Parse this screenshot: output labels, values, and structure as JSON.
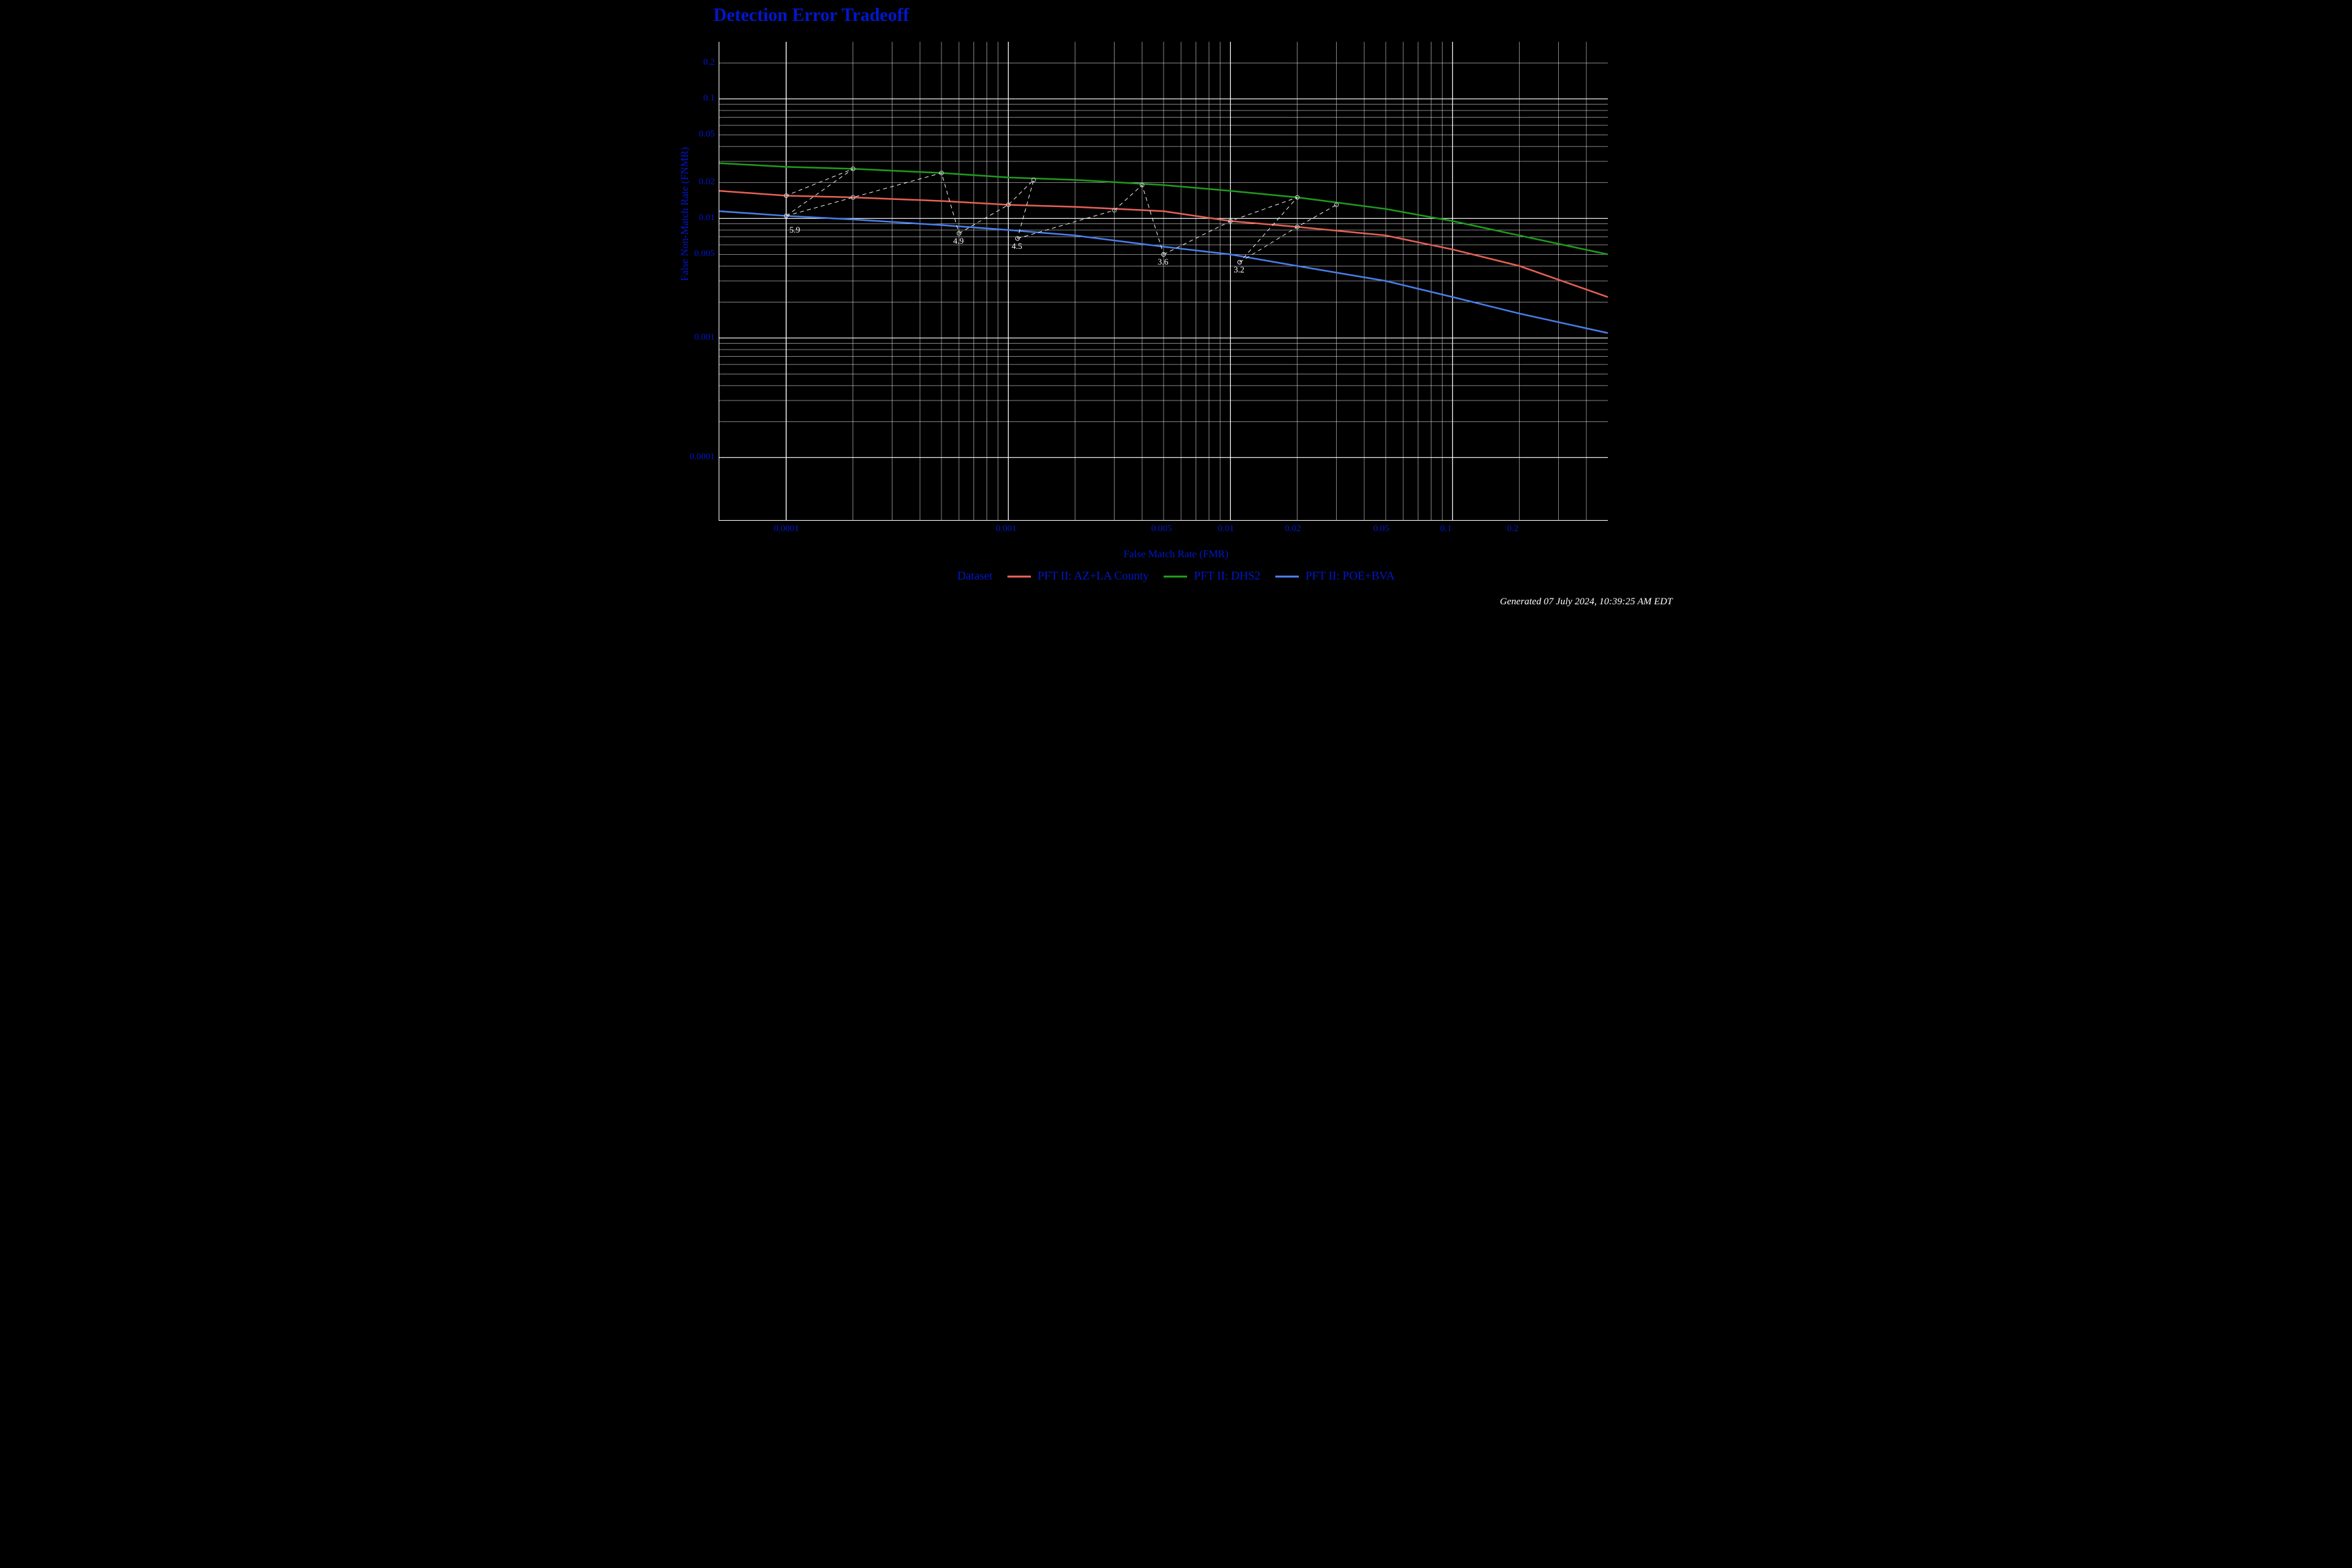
{
  "chart_data": {
    "type": "line",
    "title": "Detection Error Tradeoff",
    "xlabel": "False Match Rate (FMR)",
    "ylabel": "False Non-Match Rate (FNMR)",
    "xscale": "log",
    "yscale": "log",
    "xlim": [
      5e-05,
      0.5
    ],
    "ylim": [
      3e-05,
      0.3
    ],
    "xticks": [
      0.0001,
      0.001,
      0.005,
      0.01,
      0.02,
      0.05,
      0.1,
      0.2
    ],
    "yticks": [
      0.0001,
      0.001,
      0.005,
      0.01,
      0.02,
      0.05,
      0.1,
      0.2
    ],
    "legend_title": "Dataset",
    "series": [
      {
        "name": "PFT II: AZ+LA County",
        "color": "#e36055",
        "x": [
          5e-05,
          0.0001,
          0.0002,
          0.0005,
          0.001,
          0.002,
          0.005,
          0.01,
          0.02,
          0.05,
          0.1,
          0.2,
          0.5
        ],
        "y": [
          0.017,
          0.0155,
          0.015,
          0.014,
          0.013,
          0.0125,
          0.0115,
          0.0095,
          0.0085,
          0.0072,
          0.0055,
          0.004,
          0.0022
        ]
      },
      {
        "name": "PFT II: DHS2",
        "color": "#1f9a1f",
        "x": [
          5e-05,
          0.0001,
          0.0002,
          0.0005,
          0.001,
          0.002,
          0.005,
          0.01,
          0.02,
          0.05,
          0.1,
          0.2,
          0.5
        ],
        "y": [
          0.029,
          0.027,
          0.026,
          0.024,
          0.022,
          0.021,
          0.019,
          0.017,
          0.015,
          0.012,
          0.0095,
          0.0072,
          0.005
        ]
      },
      {
        "name": "PFT II: POE+BVA",
        "color": "#4a7de8",
        "x": [
          5e-05,
          0.0001,
          0.0002,
          0.0005,
          0.001,
          0.002,
          0.005,
          0.01,
          0.02,
          0.05,
          0.1,
          0.2,
          0.5
        ],
        "y": [
          0.0115,
          0.0105,
          0.0098,
          0.0088,
          0.008,
          0.0072,
          0.0058,
          0.005,
          0.004,
          0.003,
          0.0022,
          0.0016,
          0.0011
        ]
      }
    ],
    "iso_lines_dashed": true,
    "iso_labels": [
      {
        "label": "5.9",
        "x": 0.00011,
        "y": 0.0093
      },
      {
        "label": "4.9",
        "x": 0.0006,
        "y": 0.0075
      },
      {
        "label": "4.5",
        "x": 0.0011,
        "y": 0.0068
      },
      {
        "label": "3.6",
        "x": 0.005,
        "y": 0.005
      },
      {
        "label": "3.2",
        "x": 0.011,
        "y": 0.0043
      }
    ],
    "timestamp": "Generated 07 July 2024, 10:39:25 AM EDT"
  }
}
